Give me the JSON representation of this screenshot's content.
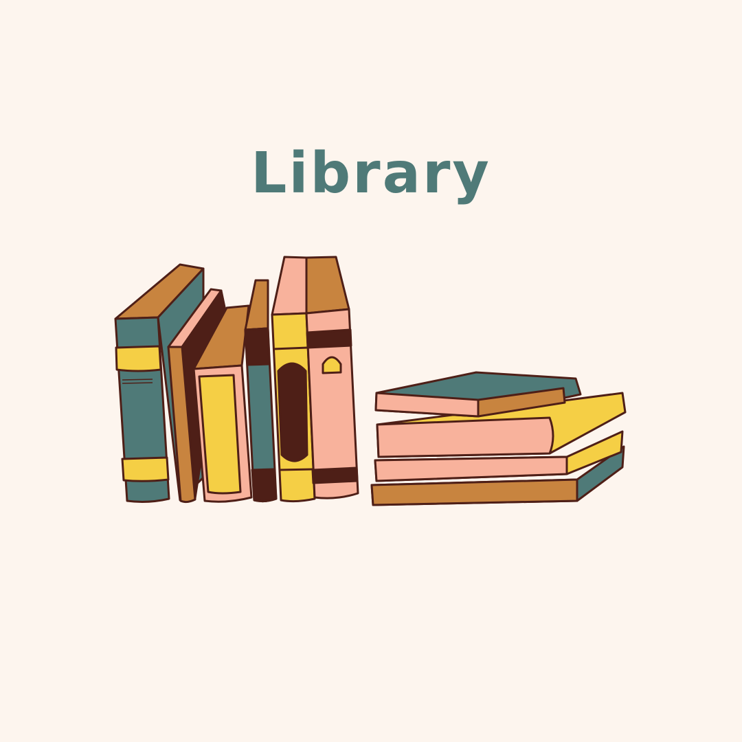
{
  "title": "Library",
  "colors": {
    "background": "#fdf5ee",
    "teal": "#4f7a78",
    "yellow": "#f5cf45",
    "pink": "#f8b29c",
    "brown": "#c8843f",
    "outline": "#4e1f17"
  }
}
